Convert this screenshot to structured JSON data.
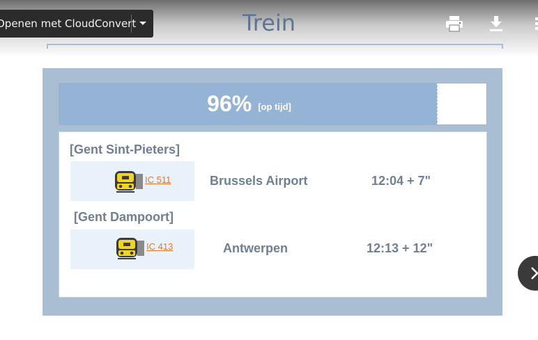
{
  "viewer": {
    "open_with_label": "Openen met CloudConvert",
    "toolbar_icons": [
      "printer-icon",
      "download-icon",
      "more-vert-icon"
    ]
  },
  "slide": {
    "title": "Trein",
    "punctuality": {
      "percent_text": "96%",
      "note": "[op tijd]",
      "fraction": 0.886
    },
    "departures": [
      {
        "station": "[Gent Sint-Pieters]",
        "train": "IC 511",
        "destination": "Brussels Airport",
        "time": "12:04 + 7\""
      },
      {
        "station": "[Gent Dampoort]",
        "train": "IC 413",
        "destination": "Antwerpen",
        "time": "12:13 + 12\""
      }
    ]
  },
  "colors": {
    "panel": "#a9bdd3",
    "bar_fill": "#95b4d5",
    "text": "#6f8094",
    "train_code": "#e5782e"
  }
}
